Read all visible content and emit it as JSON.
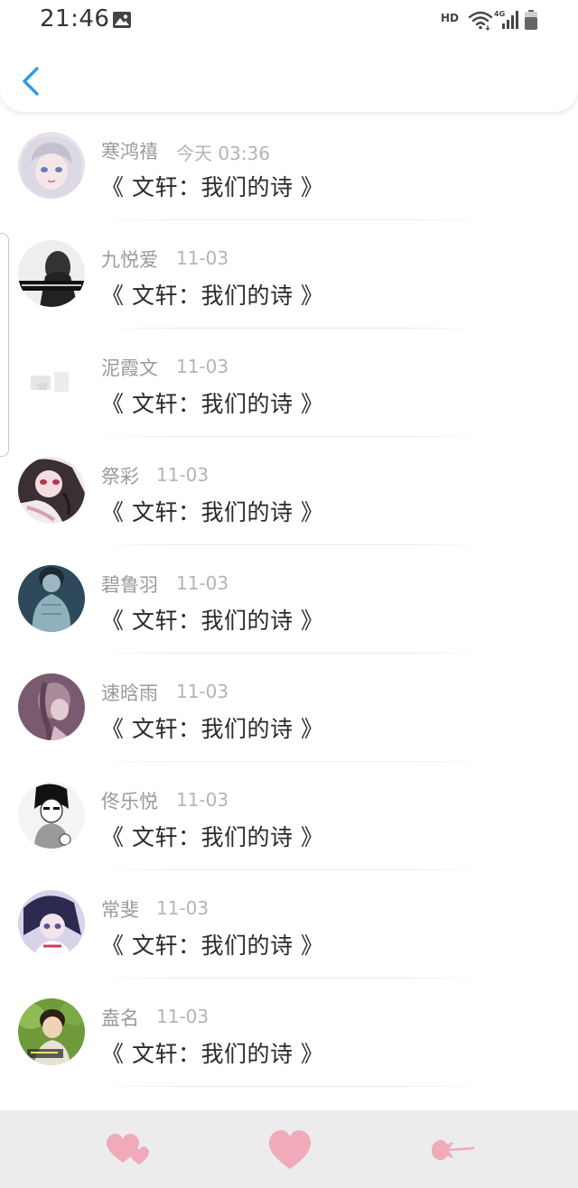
{
  "status_bar": {
    "time": "21:46",
    "hd_label": "HD",
    "network_label": "4G"
  },
  "header": {
    "back_icon": "chevron-left-icon",
    "accent_color": "#2f9be8"
  },
  "list": {
    "items": [
      {
        "name": "寒鸿禧",
        "time": "今天 03:36",
        "title": "《 文轩：我们的诗 》",
        "avatar": "anime-silver-hair"
      },
      {
        "name": "九悦爱",
        "time": "11-03",
        "title": "《 文轩：我们的诗 》",
        "avatar": "dark-silhouette"
      },
      {
        "name": "泥霞文",
        "time": "11-03",
        "title": "《 文轩：我们的诗 》",
        "avatar": "faded-white"
      },
      {
        "name": "祭彩",
        "time": "11-03",
        "title": "《 文轩：我们的诗 》",
        "avatar": "anime-dark-hair"
      },
      {
        "name": "碧鲁羽",
        "time": "11-03",
        "title": "《 文轩：我们的诗 》",
        "avatar": "blue-figure"
      },
      {
        "name": "速晗雨",
        "time": "11-03",
        "title": "《 文轩：我们的诗 》",
        "avatar": "pink-braid"
      },
      {
        "name": "佟乐悦",
        "time": "11-03",
        "title": "《 文轩：我们的诗 》",
        "avatar": "sketch-boy"
      },
      {
        "name": "常斐",
        "time": "11-03",
        "title": "《 文轩：我们的诗 》",
        "avatar": "anime-purple"
      },
      {
        "name": "盍名",
        "time": "11-03",
        "title": "《 文轩：我们的诗 》",
        "avatar": "green-photo"
      }
    ]
  },
  "bottom_bar": {
    "buttons": [
      {
        "icon": "double-heart-icon",
        "color": "#f0aab9"
      },
      {
        "icon": "heart-icon",
        "color": "#f0aab9"
      },
      {
        "icon": "arrow-heart-icon",
        "color": "#f0aab9"
      }
    ]
  },
  "colors": {
    "name_text": "#9a9a9a",
    "time_text": "#b4b4b4",
    "title_text": "#2a2a2a",
    "bottom_bar_bg": "#ececec",
    "heart_pink": "#f0aab9"
  }
}
